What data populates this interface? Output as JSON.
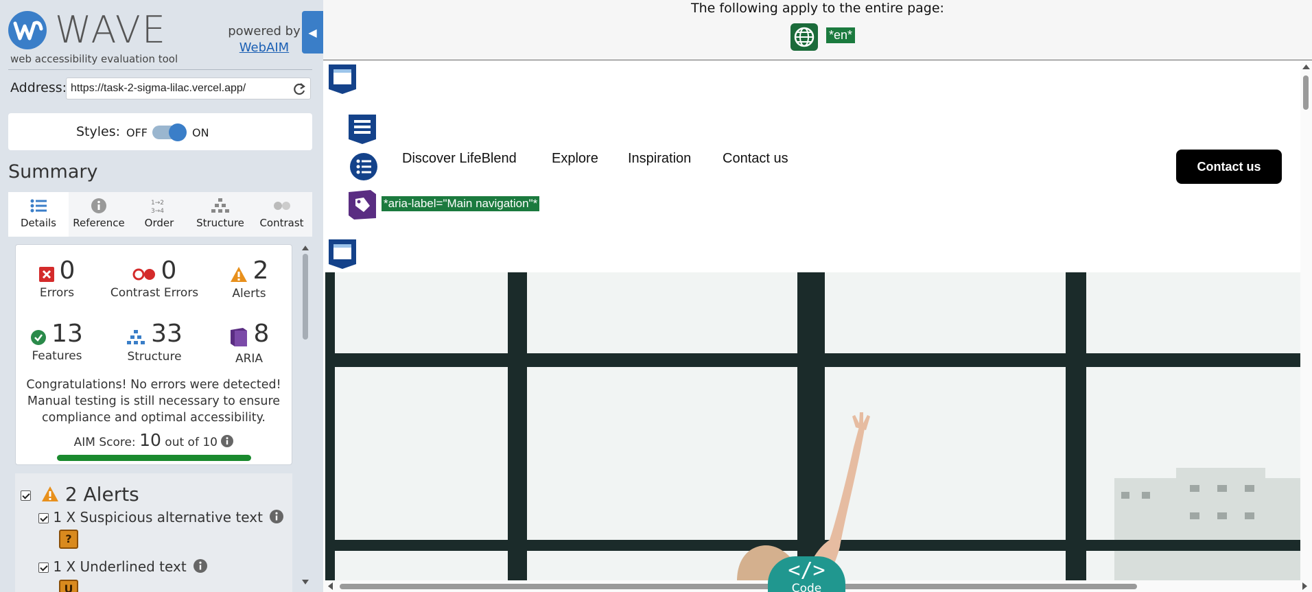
{
  "wave": {
    "logo_text": "WAVE",
    "tagline": "web accessibility evaluation tool",
    "powered_by": "powered by",
    "powered_link": "WebAIM",
    "collapse_glyph": "◀",
    "address_label": "Address:",
    "address_value": "https://task-2-sigma-lilac.vercel.app/",
    "styles_label": "Styles:",
    "styles_off": "OFF",
    "styles_on": "ON",
    "summary_title": "Summary",
    "tabs": [
      {
        "label": "Details",
        "icon": "list-icon"
      },
      {
        "label": "Reference",
        "icon": "info-icon"
      },
      {
        "label": "Order",
        "icon": "order-icon"
      },
      {
        "label": "Structure",
        "icon": "structure-icon"
      },
      {
        "label": "Contrast",
        "icon": "contrast-icon"
      }
    ],
    "stats": {
      "errors": {
        "count": "0",
        "label": "Errors"
      },
      "contrast": {
        "count": "0",
        "label": "Contrast Errors"
      },
      "alerts": {
        "count": "2",
        "label": "Alerts"
      },
      "features": {
        "count": "13",
        "label": "Features"
      },
      "structure": {
        "count": "33",
        "label": "Structure"
      },
      "aria": {
        "count": "8",
        "label": "ARIA"
      }
    },
    "congrats": "Congratulations! No errors were detected! Manual testing is still necessary to ensure compliance and optimal accessibility.",
    "aim_prefix": "AIM Score:",
    "aim_value": "10",
    "aim_suffix": "out of 10",
    "aim_score_fraction": 1.0,
    "alerts_heading": "2 Alerts",
    "alert_items": [
      {
        "label": "1 X Suspicious alternative text"
      },
      {
        "label": "1 X Underlined text"
      }
    ]
  },
  "preview": {
    "banner_text": "The following apply to the entire page:",
    "lang_label": "*en*",
    "nav_links": [
      "Discover LifeBlend",
      "Explore",
      "Inspiration",
      "Contact us"
    ],
    "contact_button": "Contact us",
    "aria_label_tag": "*aria-label=\"Main navigation\"*",
    "code_tab_glyph": "</>",
    "code_tab_label": "Code"
  },
  "colors": {
    "wave_blue": "#3a7ec8",
    "panel_bg": "#dde3ea",
    "success_green": "#1a8a2e",
    "aria_purple": "#5a2d82",
    "tag_green": "#1b7a3e",
    "code_teal": "#20978f"
  }
}
